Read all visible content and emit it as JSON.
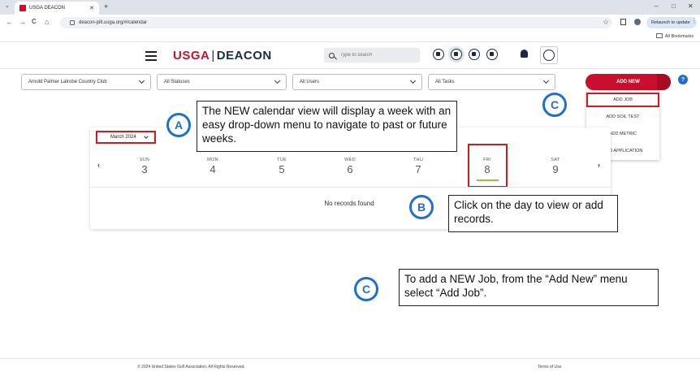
{
  "browser": {
    "tab_title": "USGA DEACON",
    "url": "deacon-pilt.usga.org/#/calendar",
    "relaunch_label": "Relaunch to update",
    "bookmarks_label": "All Bookmarks",
    "new_tab": "+",
    "nav": {
      "back": "←",
      "forward": "→",
      "reload": "C",
      "home": "⌂"
    },
    "window": {
      "minimize": "–",
      "maximize": "□",
      "close": "✕"
    }
  },
  "header": {
    "logo_usga": "USGA",
    "logo_sep": "|",
    "logo_deacon": "DEACON",
    "search_placeholder": "Type to search",
    "icons": [
      "chart-icon",
      "calendar-icon",
      "map-pin-icon",
      "settings-icon"
    ],
    "active_icon": "calendar-icon"
  },
  "filters": {
    "course": "Arnold Palmer Latrobe Country Club",
    "statuses": "All Statuses",
    "users": "All Users",
    "tasks": "All Tasks",
    "add_new_label": "ADD NEW",
    "help_label": "?"
  },
  "add_menu": {
    "items": [
      "ADD JOB",
      "ADD SOIL TEST",
      "ADD METRIC",
      "ADD APPLICATION"
    ],
    "highlighted": "ADD JOB"
  },
  "calendar": {
    "month_label": "March 2024",
    "prev_arrow": "‹",
    "next_arrow": "›",
    "days": [
      {
        "dow": "SUN",
        "num": "3"
      },
      {
        "dow": "MON",
        "num": "4"
      },
      {
        "dow": "TUE",
        "num": "5"
      },
      {
        "dow": "WED",
        "num": "6"
      },
      {
        "dow": "THU",
        "num": "7"
      },
      {
        "dow": "FRI",
        "num": "8"
      },
      {
        "dow": "SAT",
        "num": "9"
      }
    ],
    "selected_day": "FRI",
    "empty_message": "No records found"
  },
  "callouts": {
    "a_badge": "A",
    "a_text": "The NEW calendar view will display a week with an easy drop-down menu to navigate to past or future weeks.",
    "b_badge": "B",
    "b_text": "Click on the day to view or add records.",
    "c_badge": "C",
    "c_text": "To add a NEW Job, from the “Add New” menu select “Add Job”.",
    "c_badge_top": "C"
  },
  "footer": {
    "copyright": "© 2024 United States Golf Association. All Rights Reserved.",
    "terms": "Terms of Use"
  },
  "colors": {
    "brand_red": "#c8102e",
    "navy": "#1a2b4a",
    "callout_blue": "#1e6fd0",
    "highlight_red": "#d31a1a",
    "selected_day_green": "#8cc63f"
  }
}
